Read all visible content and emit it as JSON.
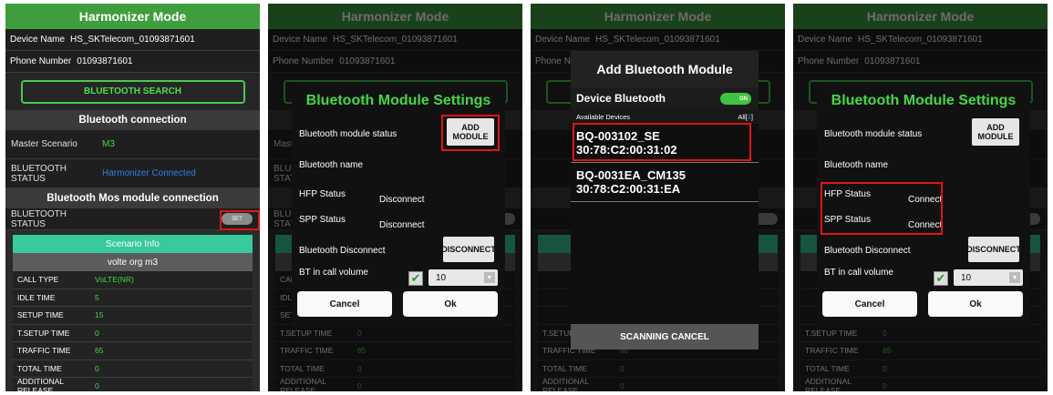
{
  "screen": {
    "title": "Harmonizer Mode",
    "device_name_label": "Device Name",
    "device_name_value": "HS_SKTelecom_01093871601",
    "phone_label": "Phone Number",
    "phone_value": "01093871601",
    "bt_search": "BLUETOOTH SEARCH",
    "bt_connection_header": "Bluetooth connection",
    "master_label": "Master Scenario",
    "master_value": "M3",
    "bt_status_label": "BLUETOOTH STATUS",
    "bt_status_value": "Harmonizer Connected",
    "mos_header": "Bluetooth Mos module connection",
    "mos_status_label": "BLUETOOTH STATUS",
    "set_toggle": "SET",
    "scenario_info": "Scenario Info",
    "scenario_name": "volte org m3",
    "table": [
      {
        "k": "CALL TYPE",
        "v": "VoLTE(NR)"
      },
      {
        "k": "IDLE TIME",
        "v": "5"
      },
      {
        "k": "SETUP TIME",
        "v": "15"
      },
      {
        "k": "T.SETUP TIME",
        "v": "0"
      },
      {
        "k": "TRAFFIC TIME",
        "v": "65"
      },
      {
        "k": "TOTAL TIME",
        "v": "0"
      },
      {
        "k": "ADDITIONAL RELEASE",
        "v": "0"
      }
    ]
  },
  "settings_dialog": {
    "title": "Bluetooth Module Settings",
    "module_status_label": "Bluetooth module status",
    "add_module": "ADD MODULE",
    "name_label": "Bluetooth name",
    "hfp_label": "HFP Status",
    "spp_label": "SPP Status",
    "disconnect_label": "Bluetooth Disconnect",
    "disconnect_button": "DISCONNECT",
    "in_call_label": "BT in call volume",
    "volume_value": "10",
    "cancel": "Cancel",
    "ok": "Ok",
    "state_a": {
      "hfp": "Disconnect",
      "spp": "Disconnect"
    },
    "state_b": {
      "hfp": "Connect",
      "spp": "Connect"
    }
  },
  "add_dialog": {
    "title": "Add Bluetooth Module",
    "device_bt_label": "Device Bluetooth",
    "toggle": "ON",
    "available_label": "Available Devices",
    "count_prefix": "All[",
    "count": "2",
    "count_suffix": "]",
    "devices": [
      {
        "name": "BQ-003102_SE",
        "mac": "30:78:C2:00:31:02"
      },
      {
        "name": "BQ-0031EA_CM135",
        "mac": "30:78:C2:00:31:EA"
      }
    ],
    "scanning_cancel": "SCANNING CANCEL"
  },
  "colors": {
    "accent_green": "#45d845",
    "header_green": "#3e9e3e",
    "highlight_red": "#e01414",
    "link_blue": "#2f7fe5"
  }
}
